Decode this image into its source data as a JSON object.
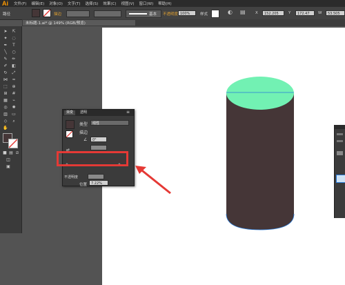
{
  "app": {
    "logo": "Ai",
    "menu": [
      "文件(F)",
      "编辑(E)",
      "对象(O)",
      "文字(T)",
      "选择(S)",
      "效果(C)",
      "视图(V)",
      "窗口(W)",
      "帮助(H)"
    ]
  },
  "control_bar": {
    "path_label": "路径",
    "stroke_label": "描边",
    "stroke_style": "基本",
    "opacity_label": "不透明度",
    "opacity_value": "100%",
    "style_label": "样式",
    "x_value": "152.205",
    "y_value": "172.47",
    "w_value": "53.505"
  },
  "document": {
    "tab_title": "未标题-1.ai* @ 149% (RGB/预览)"
  },
  "gradient_panel": {
    "tab_gradient": "渐变",
    "tab_transparency": "透明",
    "type_label": "类型",
    "type_value": "线性",
    "stroke_label": "描边",
    "angle_value": "0°",
    "opacity_label": "不透明度",
    "position_label": "位置",
    "position_value": "7.22%"
  },
  "colors": {
    "cylinder_body": "#453637",
    "cylinder_top": "#72f1b3",
    "outline": "#2a7bd8",
    "highlight": "#e53935",
    "ui_dark": "#3b3b3b",
    "artboard": "#ffffff"
  }
}
